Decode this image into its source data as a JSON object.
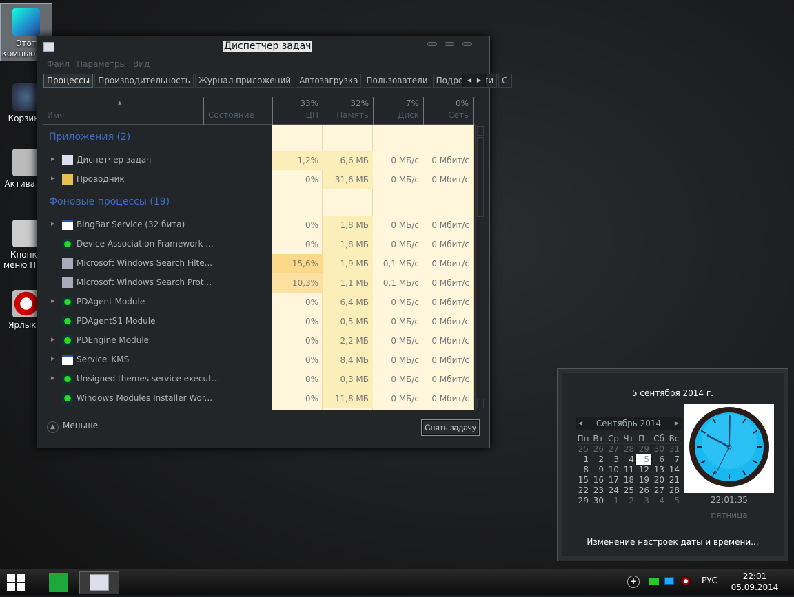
{
  "desktop": {
    "icons": [
      {
        "label": "Этот компьютер",
        "selected": true
      },
      {
        "label": "Корзина"
      },
      {
        "label": "Активат..."
      },
      {
        "label": "Кнопка меню ПУ..."
      },
      {
        "label": "Ярлык..."
      }
    ]
  },
  "window": {
    "title": "Диспетчер задач",
    "menu": [
      "Файл",
      "Параметры",
      "Вид"
    ],
    "tabs": [
      "Процессы",
      "Производительность",
      "Журнал приложений",
      "Автозагрузка",
      "Пользователи",
      "Подробности",
      "С..."
    ],
    "active_tab": "Процессы",
    "columns": {
      "name": "Имя",
      "status": "Состояние",
      "cpu": {
        "pct": "33%",
        "label": "ЦП"
      },
      "mem": {
        "pct": "32%",
        "label": "Память"
      },
      "disk": {
        "pct": "7%",
        "label": "Диск"
      },
      "net": {
        "pct": "0%",
        "label": "Сеть"
      }
    },
    "groups": [
      {
        "title": "Приложения (2)",
        "rows": [
          {
            "name": "Диспетчер задач",
            "expand": true,
            "icon": "taskmgr-icon",
            "cpu": "1,2%",
            "mem": "6,6 МБ",
            "disk": "0 МБ/с",
            "net": "0 Мбит/с"
          },
          {
            "name": "Проводник",
            "expand": true,
            "icon": "folder-icon",
            "cpu": "0%",
            "mem": "31,6 МБ",
            "disk": "0 МБ/с",
            "net": "0 Мбит/с"
          }
        ]
      },
      {
        "title": "Фоновые процессы (19)",
        "rows": [
          {
            "name": "BingBar Service (32 бита)",
            "expand": true,
            "icon": "window-icon",
            "cpu": "0%",
            "mem": "1,8 МБ",
            "disk": "0 МБ/с",
            "net": "0 Мбит/с"
          },
          {
            "name": "Device Association Framework ...",
            "expand": false,
            "icon": "service-icon",
            "cpu": "0%",
            "mem": "1,8 МБ",
            "disk": "0 МБ/с",
            "net": "0 Мбит/с"
          },
          {
            "name": "Microsoft Windows Search Filte...",
            "expand": false,
            "icon": "search-service-icon",
            "cpu": "15,6%",
            "mem": "1,9 МБ",
            "disk": "0,1 МБ/с",
            "net": "0 Мбит/с"
          },
          {
            "name": "Microsoft Windows Search Prot...",
            "expand": false,
            "icon": "search-service-icon",
            "cpu": "10,3%",
            "mem": "1,1 МБ",
            "disk": "0,1 МБ/с",
            "net": "0 Мбит/с"
          },
          {
            "name": "PDAgent Module",
            "expand": true,
            "icon": "service-icon",
            "cpu": "0%",
            "mem": "6,4 МБ",
            "disk": "0 МБ/с",
            "net": "0 Мбит/с"
          },
          {
            "name": "PDAgentS1 Module",
            "expand": false,
            "icon": "service-icon",
            "cpu": "0%",
            "mem": "0,5 МБ",
            "disk": "0 МБ/с",
            "net": "0 Мбит/с"
          },
          {
            "name": "PDEngine Module",
            "expand": true,
            "icon": "service-icon",
            "cpu": "0%",
            "mem": "2,2 МБ",
            "disk": "0 МБ/с",
            "net": "0 Мбит/с"
          },
          {
            "name": "Service_KMS",
            "expand": true,
            "icon": "window-icon",
            "cpu": "0%",
            "mem": "8,4 МБ",
            "disk": "0 МБ/с",
            "net": "0 Мбит/с"
          },
          {
            "name": "Unsigned themes service execut...",
            "expand": true,
            "icon": "service-icon",
            "cpu": "0%",
            "mem": "0,3 МБ",
            "disk": "0 МБ/с",
            "net": "0 Мбит/с"
          },
          {
            "name": "Windows Modules Installer Wor...",
            "expand": false,
            "icon": "service-icon",
            "cpu": "0%",
            "mem": "11,8 МБ",
            "disk": "0 МБ/с",
            "net": "0 Мбит/с"
          }
        ]
      }
    ],
    "footer": {
      "less": "Меньше",
      "end_task": "Снять задачу"
    }
  },
  "calendar": {
    "date_long": "5 сентября 2014 г.",
    "month": "Сентябрь 2014",
    "weekdays": [
      "Пн",
      "Вт",
      "Ср",
      "Чт",
      "Пт",
      "Сб",
      "Вс"
    ],
    "weeks": [
      [
        "25",
        "26",
        "27",
        "28",
        "29",
        "30",
        "31"
      ],
      [
        "1",
        "2",
        "3",
        "4",
        "5",
        "6",
        "7"
      ],
      [
        "8",
        "9",
        "10",
        "11",
        "12",
        "13",
        "14"
      ],
      [
        "15",
        "16",
        "17",
        "18",
        "19",
        "20",
        "21"
      ],
      [
        "22",
        "23",
        "24",
        "25",
        "26",
        "27",
        "28"
      ],
      [
        "29",
        "30",
        "1",
        "2",
        "3",
        "4",
        "5"
      ]
    ],
    "today": "5",
    "time": "22:01:35",
    "weekday": "пятница",
    "change_link": "Изменение настроек даты и времени..."
  },
  "taskbar": {
    "lang": "РУС",
    "time": "22:01",
    "date": "05.09.2014",
    "tray_icons": [
      "add-icon",
      "flag-icon",
      "monitor-icon",
      "speaker-icon"
    ]
  },
  "colors": {
    "accent": "#3d6ccc",
    "cell_bg": "#fff6dc",
    "cell_mid": "#fbeeb8",
    "cell_hot": "#fcd98a"
  }
}
